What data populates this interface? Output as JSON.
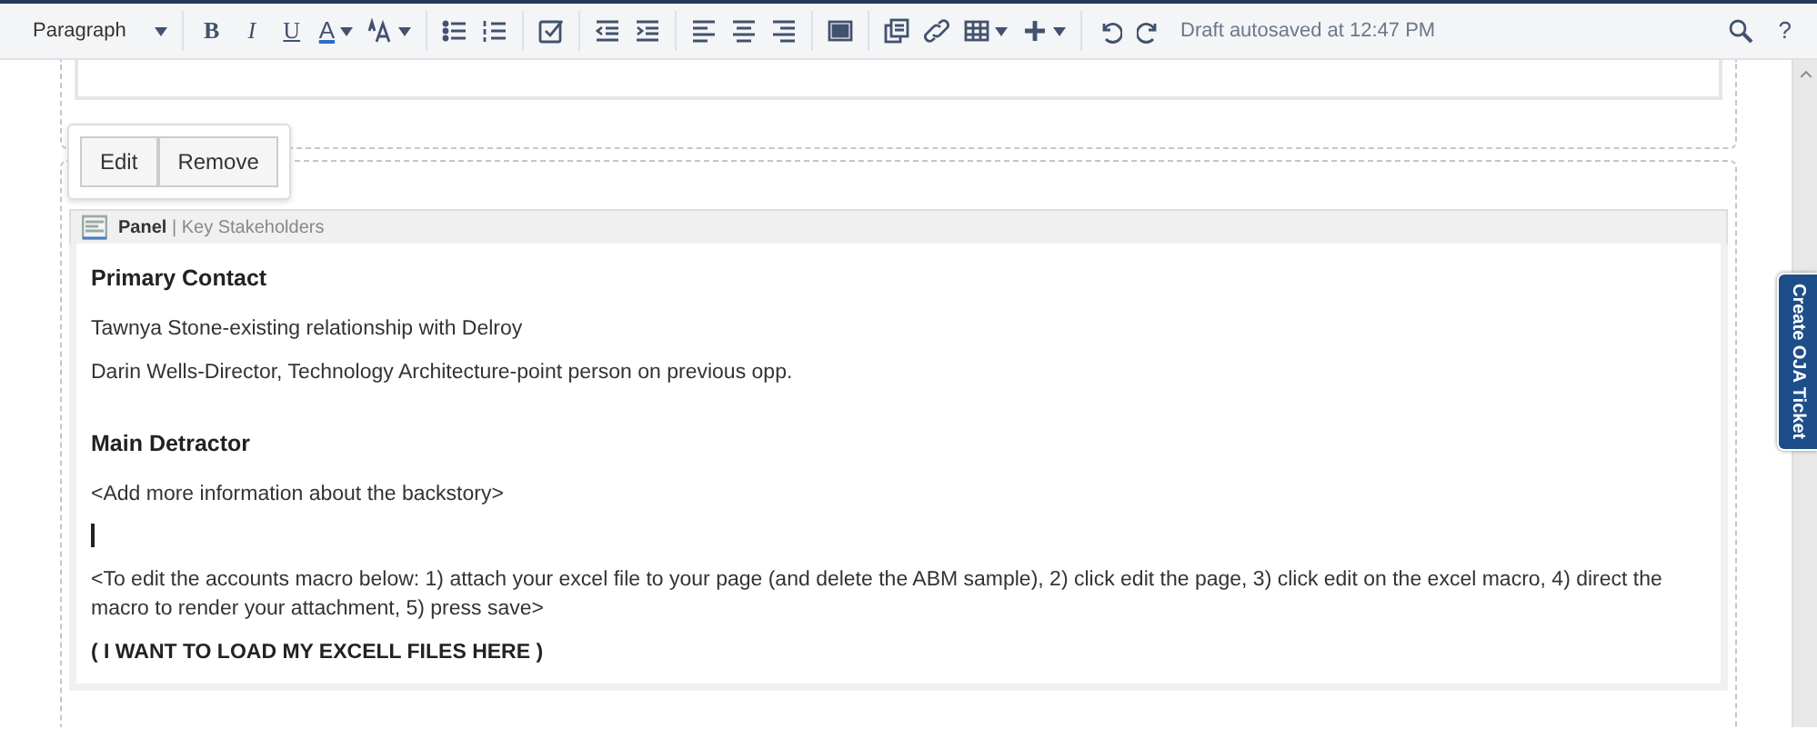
{
  "toolbar": {
    "paragraph_style": "Paragraph",
    "format_buttons": [
      "B",
      "I",
      "U"
    ],
    "text_color_button": "A",
    "status": "Draft autosaved at 12:47 PM",
    "help": "?"
  },
  "macro_popup": {
    "buttons": [
      "Edit",
      "Remove"
    ]
  },
  "panel": {
    "title": "Panel",
    "separator": "|",
    "subtitle": "Key Stakeholders",
    "blocks": [
      {
        "kind": "heading",
        "text": "Primary Contact"
      },
      {
        "kind": "paragraph",
        "text": "Tawnya Stone-existing relationship with Delroy"
      },
      {
        "kind": "paragraph",
        "text": "Darin Wells-Director, Technology Architecture-point person on previous opp."
      },
      {
        "kind": "heading",
        "text": "Main Detractor"
      },
      {
        "kind": "paragraph",
        "text": "<Add more information about the backstory>"
      },
      {
        "kind": "cursor"
      },
      {
        "kind": "paragraph",
        "text": "<To edit the accounts macro below: 1) attach your excel file to your page (and delete the ABM sample), 2) click edit the page, 3) click edit on the excel macro, 4) direct the macro to render your attachment, 5) press save>"
      },
      {
        "kind": "bold",
        "text": "( I WANT TO LOAD MY EXCELL FILES HERE )"
      }
    ]
  },
  "side_tab": {
    "label": "Create OJA Ticket"
  }
}
